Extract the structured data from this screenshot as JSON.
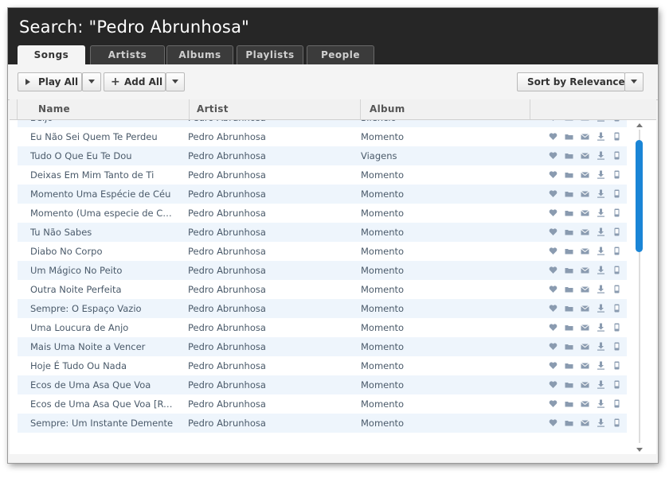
{
  "search": {
    "title": "Search: \"Pedro Abrunhosa\""
  },
  "tabs": [
    {
      "label": "Songs",
      "active": true
    },
    {
      "label": "Artists",
      "active": false
    },
    {
      "label": "Albums",
      "active": false
    },
    {
      "label": "Playlists",
      "active": false
    },
    {
      "label": "People",
      "active": false
    }
  ],
  "toolbar": {
    "play_all_label": "Play All",
    "add_all_label": "Add All",
    "sort_label": "Sort by Relevance"
  },
  "columns": {
    "name": "Name",
    "artist": "Artist",
    "album": "Album"
  },
  "colors": {
    "accent": "#1a85d6",
    "header_bg": "#262626",
    "row_alt": "#eef5fc",
    "icon": "#8a9bb0"
  },
  "row_icons": [
    "heart-icon",
    "folder-icon",
    "mail-icon",
    "download-icon",
    "phone-icon"
  ],
  "rows": [
    {
      "name": "Beijo",
      "artist": "Pedro Abrunhosa",
      "album": "Silencio"
    },
    {
      "name": "Eu Não Sei Quem Te Perdeu",
      "artist": "Pedro Abrunhosa",
      "album": "Momento"
    },
    {
      "name": "Tudo O Que Eu Te Dou",
      "artist": "Pedro Abrunhosa",
      "album": "Viagens"
    },
    {
      "name": "Deixas Em Mim Tanto de Ti",
      "artist": "Pedro Abrunhosa",
      "album": "Momento"
    },
    {
      "name": "Momento Uma Espécie de Céu",
      "artist": "Pedro Abrunhosa",
      "album": "Momento"
    },
    {
      "name": "Momento (Uma especie de Céu)",
      "artist": "Pedro Abrunhosa",
      "album": "Momento"
    },
    {
      "name": "Tu Não Sabes",
      "artist": "Pedro Abrunhosa",
      "album": "Momento"
    },
    {
      "name": "Diabo No Corpo",
      "artist": "Pedro Abrunhosa",
      "album": "Momento"
    },
    {
      "name": "Um Mágico No Peito",
      "artist": "Pedro Abrunhosa",
      "album": "Momento"
    },
    {
      "name": "Outra Noite Perfeita",
      "artist": "Pedro Abrunhosa",
      "album": "Momento"
    },
    {
      "name": "Sempre: O Espaço Vazio",
      "artist": "Pedro Abrunhosa",
      "album": "Momento"
    },
    {
      "name": "Uma Loucura de Anjo",
      "artist": "Pedro Abrunhosa",
      "album": "Momento"
    },
    {
      "name": "Mais Uma Noite a Vencer",
      "artist": "Pedro Abrunhosa",
      "album": "Momento"
    },
    {
      "name": "Hoje É Tudo Ou Nada",
      "artist": "Pedro Abrunhosa",
      "album": "Momento"
    },
    {
      "name": "Ecos de Uma Asa Que Voa",
      "artist": "Pedro Abrunhosa",
      "album": "Momento"
    },
    {
      "name": "Ecos de Uma Asa Que Voa [Remix]",
      "artist": "Pedro Abrunhosa",
      "album": "Momento"
    },
    {
      "name": "Sempre: Um Instante Demente",
      "artist": "Pedro Abrunhosa",
      "album": "Momento"
    }
  ]
}
